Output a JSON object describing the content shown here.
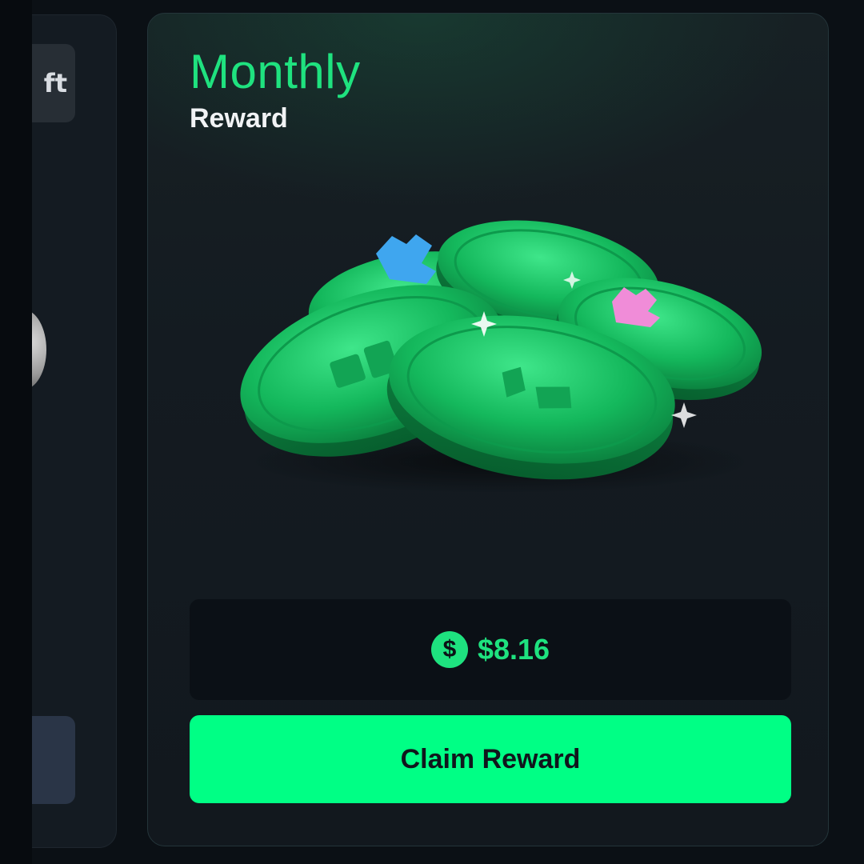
{
  "side_card": {
    "tag_label": "ft"
  },
  "reward_card": {
    "title": "Monthly",
    "subtitle": "Reward",
    "amount": "$8.16",
    "currency_icon_glyph": "$",
    "claim_label": "Claim Reward"
  },
  "colors": {
    "accent_green": "#00ff85",
    "title_green": "#1fe27f",
    "card_background": "#141b21",
    "page_background": "#0b1015"
  },
  "icons": {
    "currency": "dollar-coin-icon",
    "illustration": "green-coins-pile-illustration"
  }
}
